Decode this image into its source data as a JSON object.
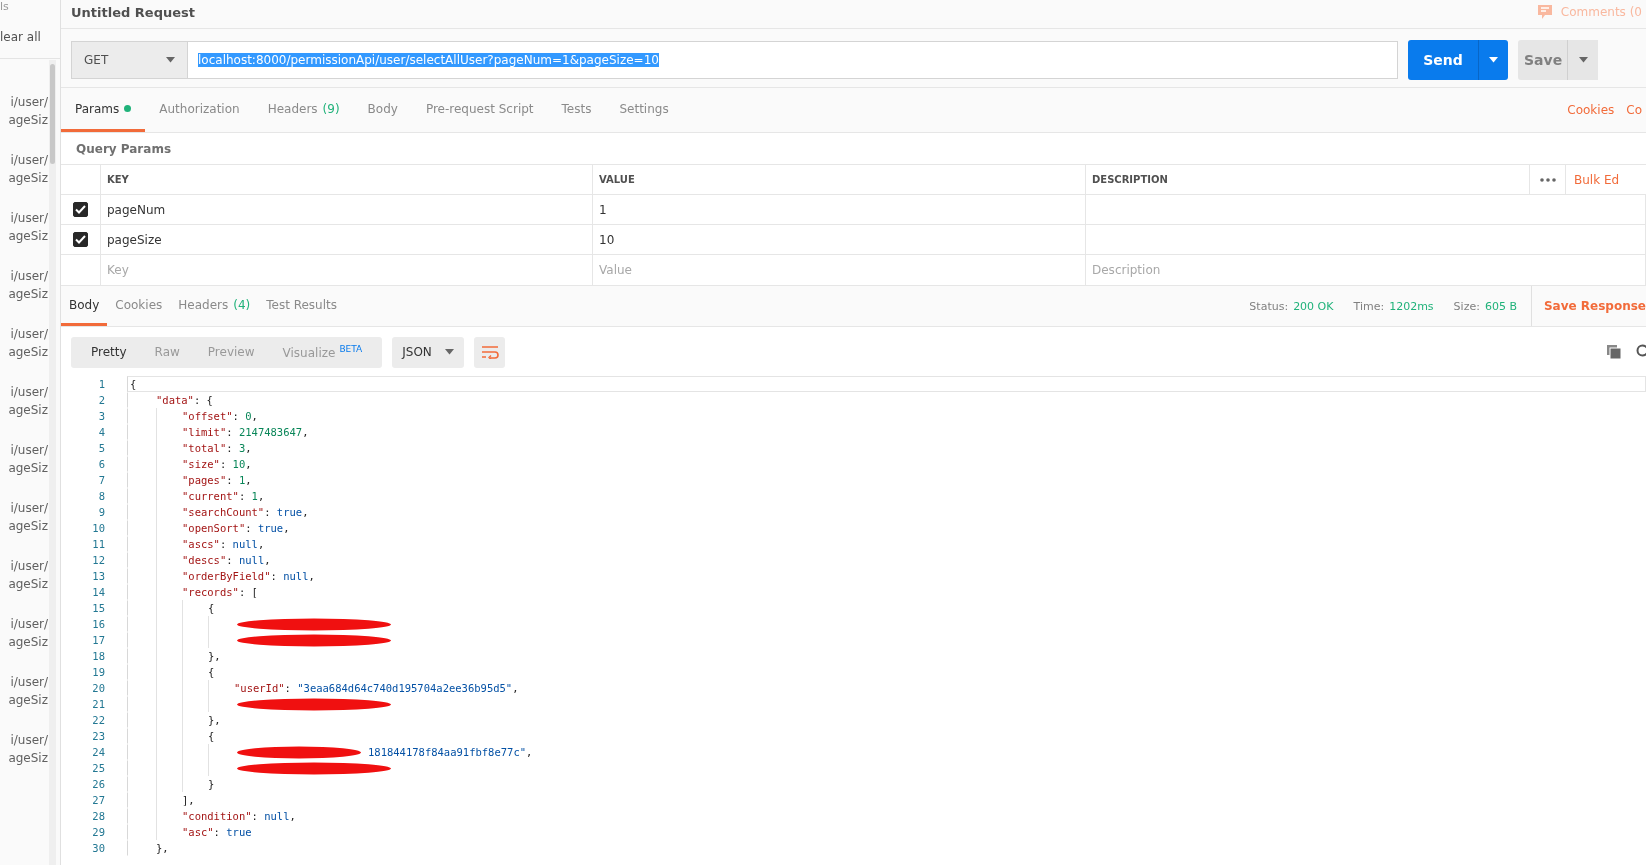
{
  "sidebar": {
    "top_text": "ls",
    "clear_label": "lear all",
    "items": [
      {
        "lines": [
          "i/user/",
          "ageSiz"
        ]
      },
      {
        "lines": [
          "i/user/",
          "ageSiz"
        ]
      },
      {
        "lines": [
          "i/user/",
          "ageSiz"
        ]
      },
      {
        "lines": [
          "i/user/",
          "ageSiz"
        ]
      },
      {
        "lines": [
          "i/user/",
          "ageSiz"
        ]
      },
      {
        "lines": [
          "i/user/",
          "ageSiz"
        ]
      },
      {
        "lines": [
          "i/user/",
          "ageSiz"
        ]
      },
      {
        "lines": [
          "i/user/",
          "ageSiz"
        ]
      },
      {
        "lines": [
          "i/user/",
          "ageSiz"
        ]
      },
      {
        "lines": [
          "i/user/",
          "ageSiz"
        ]
      },
      {
        "lines": [
          "i/user/",
          "ageSiz"
        ]
      },
      {
        "lines": [
          "i/user/",
          "ageSiz"
        ]
      }
    ]
  },
  "request": {
    "title": "Untitled Request",
    "comments": "Comments (0",
    "method": "GET",
    "url": "localhost:8000/permissionApi/user/selectAllUser?pageNum=1&pageSize=10",
    "url_selected": true,
    "send": "Send",
    "save": "Save"
  },
  "request_tabs": [
    {
      "label": "Params",
      "selected": true,
      "indicator": true
    },
    {
      "label": "Authorization",
      "selected": false,
      "indicator": false
    },
    {
      "label": "Headers",
      "count": "(9)",
      "selected": false,
      "indicator": false
    },
    {
      "label": "Body",
      "selected": false,
      "indicator": false
    },
    {
      "label": "Pre-request Script",
      "selected": false,
      "indicator": false
    },
    {
      "label": "Tests",
      "selected": false,
      "indicator": false
    },
    {
      "label": "Settings",
      "selected": false,
      "indicator": false
    }
  ],
  "request_links": [
    "Cookies",
    "Co"
  ],
  "query_params": {
    "title": "Query Params",
    "columns": [
      "KEY",
      "VALUE",
      "DESCRIPTION"
    ],
    "bulk_edit": "Bulk Ed",
    "rows": [
      {
        "checked": true,
        "key": "pageNum",
        "value": "1"
      },
      {
        "checked": true,
        "key": "pageSize",
        "value": "10"
      }
    ],
    "new_row": {
      "key": {
        "placeholder": "Key"
      },
      "value": {
        "placeholder": "Value"
      },
      "description": {
        "placeholder": "Description"
      }
    }
  },
  "response": {
    "tabs": [
      {
        "label": "Body",
        "selected": true
      },
      {
        "label": "Cookies",
        "selected": false
      },
      {
        "label": "Headers",
        "count": "(4)",
        "selected": false
      },
      {
        "label": "Test Results",
        "selected": false
      }
    ],
    "status_label": "Status:",
    "status": "200 OK",
    "time_label": "Time:",
    "time": "1202ms",
    "size_label": "Size:",
    "size": "605 B",
    "save_response": "Save Response",
    "view_modes": [
      {
        "label": "Pretty",
        "selected": true
      },
      {
        "label": "Raw",
        "selected": false
      },
      {
        "label": "Preview",
        "selected": false
      },
      {
        "label": "Visualize",
        "badge": "BETA",
        "selected": false
      }
    ],
    "format": "JSON",
    "lines": [
      {
        "n": "1",
        "current": true,
        "tokens": [
          {
            "text": "{",
            "kind": "punct"
          }
        ],
        "children": [
          {
            "n": "2",
            "tokens": [
              {
                "text": "\"data\"",
                "kind": "key"
              },
              {
                "text": ": {",
                "kind": "punct"
              }
            ],
            "children": [
              {
                "n": "3",
                "tokens": [
                  {
                    "text": "\"offset\"",
                    "kind": "key"
                  },
                  {
                    "text": ": ",
                    "kind": "punct"
                  },
                  {
                    "text": "0",
                    "kind": "number"
                  },
                  {
                    "text": ",",
                    "kind": "punct"
                  }
                ]
              },
              {
                "n": "4",
                "tokens": [
                  {
                    "text": "\"limit\"",
                    "kind": "key"
                  },
                  {
                    "text": ": ",
                    "kind": "punct"
                  },
                  {
                    "text": "2147483647",
                    "kind": "number"
                  },
                  {
                    "text": ",",
                    "kind": "punct"
                  }
                ]
              },
              {
                "n": "5",
                "tokens": [
                  {
                    "text": "\"total\"",
                    "kind": "key"
                  },
                  {
                    "text": ": ",
                    "kind": "punct"
                  },
                  {
                    "text": "3",
                    "kind": "number"
                  },
                  {
                    "text": ",",
                    "kind": "punct"
                  }
                ]
              },
              {
                "n": "6",
                "tokens": [
                  {
                    "text": "\"size\"",
                    "kind": "key"
                  },
                  {
                    "text": ": ",
                    "kind": "punct"
                  },
                  {
                    "text": "10",
                    "kind": "number"
                  },
                  {
                    "text": ",",
                    "kind": "punct"
                  }
                ]
              },
              {
                "n": "7",
                "tokens": [
                  {
                    "text": "\"pages\"",
                    "kind": "key"
                  },
                  {
                    "text": ": ",
                    "kind": "punct"
                  },
                  {
                    "text": "1",
                    "kind": "number"
                  },
                  {
                    "text": ",",
                    "kind": "punct"
                  }
                ]
              },
              {
                "n": "8",
                "tokens": [
                  {
                    "text": "\"current\"",
                    "kind": "key"
                  },
                  {
                    "text": ": ",
                    "kind": "punct"
                  },
                  {
                    "text": "1",
                    "kind": "number"
                  },
                  {
                    "text": ",",
                    "kind": "punct"
                  }
                ]
              },
              {
                "n": "9",
                "tokens": [
                  {
                    "text": "\"searchCount\"",
                    "kind": "key"
                  },
                  {
                    "text": ": ",
                    "kind": "punct"
                  },
                  {
                    "text": "true",
                    "kind": "keyword"
                  },
                  {
                    "text": ",",
                    "kind": "punct"
                  }
                ]
              },
              {
                "n": "10",
                "tokens": [
                  {
                    "text": "\"openSort\"",
                    "kind": "key"
                  },
                  {
                    "text": ": ",
                    "kind": "punct"
                  },
                  {
                    "text": "true",
                    "kind": "keyword"
                  },
                  {
                    "text": ",",
                    "kind": "punct"
                  }
                ]
              },
              {
                "n": "11",
                "tokens": [
                  {
                    "text": "\"ascs\"",
                    "kind": "key"
                  },
                  {
                    "text": ": ",
                    "kind": "punct"
                  },
                  {
                    "text": "null",
                    "kind": "keyword"
                  },
                  {
                    "text": ",",
                    "kind": "punct"
                  }
                ]
              },
              {
                "n": "12",
                "tokens": [
                  {
                    "text": "\"descs\"",
                    "kind": "key"
                  },
                  {
                    "text": ": ",
                    "kind": "punct"
                  },
                  {
                    "text": "null",
                    "kind": "keyword"
                  },
                  {
                    "text": ",",
                    "kind": "punct"
                  }
                ]
              },
              {
                "n": "13",
                "tokens": [
                  {
                    "text": "\"orderByField\"",
                    "kind": "key"
                  },
                  {
                    "text": ": ",
                    "kind": "punct"
                  },
                  {
                    "text": "null",
                    "kind": "keyword"
                  },
                  {
                    "text": ",",
                    "kind": "punct"
                  }
                ]
              },
              {
                "n": "14",
                "tokens": [
                  {
                    "text": "\"records\"",
                    "kind": "key"
                  },
                  {
                    "text": ": [",
                    "kind": "punct"
                  }
                ],
                "children": [
                  {
                    "n": "15",
                    "tokens": [
                      {
                        "text": "{",
                        "kind": "punct"
                      }
                    ],
                    "children": [
                      {
                        "n": "16",
                        "redacted": true
                      },
                      {
                        "n": "17",
                        "redacted": true
                      }
                    ]
                  },
                  {
                    "n": "18",
                    "tokens": [
                      {
                        "text": "},",
                        "kind": "punct"
                      }
                    ]
                  },
                  {
                    "n": "19",
                    "tokens": [
                      {
                        "text": "{",
                        "kind": "punct"
                      }
                    ],
                    "children": [
                      {
                        "n": "20",
                        "tokens": [
                          {
                            "text": "\"userId\"",
                            "kind": "key"
                          },
                          {
                            "text": ": ",
                            "kind": "punct"
                          },
                          {
                            "text": "\"3eaa684d64c740d195704a2ee36b95d5\"",
                            "kind": "string"
                          },
                          {
                            "text": ",",
                            "kind": "punct"
                          }
                        ]
                      },
                      {
                        "n": "21",
                        "redacted": true
                      }
                    ]
                  },
                  {
                    "n": "22",
                    "tokens": [
                      {
                        "text": "},",
                        "kind": "punct"
                      }
                    ]
                  },
                  {
                    "n": "23",
                    "tokens": [
                      {
                        "text": "{",
                        "kind": "punct"
                      }
                    ],
                    "children": [
                      {
                        "n": "24",
                        "redacted": true,
                        "tokens": [
                          {
                            "text": "181844178f84aa91fbf8e77c\"",
                            "kind": "string"
                          },
                          {
                            "text": ",",
                            "kind": "punct"
                          }
                        ]
                      },
                      {
                        "n": "25",
                        "redacted": true
                      }
                    ]
                  },
                  {
                    "n": "26",
                    "tokens": [
                      {
                        "text": "}",
                        "kind": "punct"
                      }
                    ]
                  }
                ]
              },
              {
                "n": "27",
                "tokens": [
                  {
                    "text": "],",
                    "kind": "punct"
                  }
                ]
              },
              {
                "n": "28",
                "tokens": [
                  {
                    "text": "\"condition\"",
                    "kind": "key"
                  },
                  {
                    "text": ": ",
                    "kind": "punct"
                  },
                  {
                    "text": "null",
                    "kind": "keyword"
                  },
                  {
                    "text": ",",
                    "kind": "punct"
                  }
                ]
              },
              {
                "n": "29",
                "tokens": [
                  {
                    "text": "\"asc\"",
                    "kind": "key"
                  },
                  {
                    "text": ": ",
                    "kind": "punct"
                  },
                  {
                    "text": "true",
                    "kind": "keyword"
                  }
                ]
              }
            ]
          },
          {
            "n": "30",
            "tokens": [
              {
                "text": "},",
                "kind": "punct"
              }
            ]
          }
        ]
      }
    ]
  }
}
